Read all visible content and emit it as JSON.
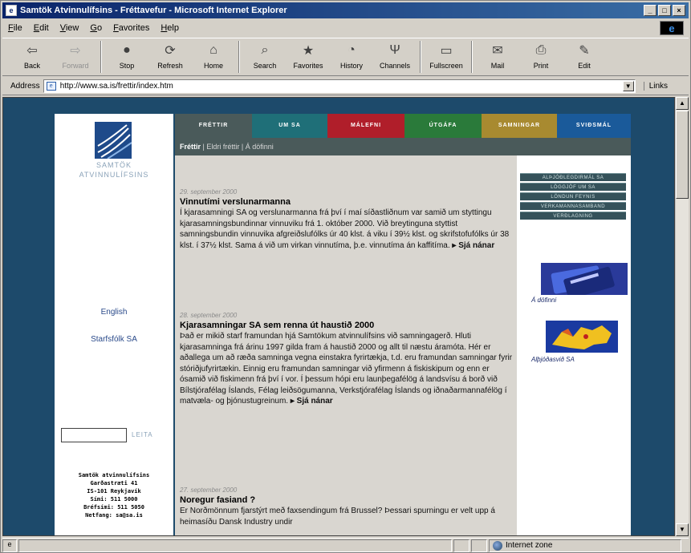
{
  "window": {
    "title": "Samtök Atvinnulífsins - Fréttavefur - Microsoft Internet Explorer",
    "controls": [
      "_",
      "□",
      "×"
    ]
  },
  "menu": [
    "File",
    "Edit",
    "View",
    "Go",
    "Favorites",
    "Help"
  ],
  "toolbar": {
    "buttons": [
      {
        "label": "Back",
        "icon": "back-arrow-icon",
        "glyph": "⇦"
      },
      {
        "label": "Forward",
        "icon": "forward-arrow-icon",
        "glyph": "⇨"
      },
      {
        "label": "Stop",
        "icon": "stop-icon",
        "glyph": "●"
      },
      {
        "label": "Refresh",
        "icon": "refresh-icon",
        "glyph": "⟳"
      },
      {
        "label": "Home",
        "icon": "home-icon",
        "glyph": "⌂"
      },
      {
        "label": "Search",
        "icon": "search-icon",
        "glyph": "⌕"
      },
      {
        "label": "Favorites",
        "icon": "favorites-icon",
        "glyph": "★"
      },
      {
        "label": "History",
        "icon": "history-icon",
        "glyph": "◔"
      },
      {
        "label": "Channels",
        "icon": "channels-icon",
        "glyph": "Ψ"
      },
      {
        "label": "Fullscreen",
        "icon": "fullscreen-icon",
        "glyph": "▭"
      },
      {
        "label": "Mail",
        "icon": "mail-icon",
        "glyph": "✉"
      },
      {
        "label": "Print",
        "icon": "print-icon",
        "glyph": "⎙"
      },
      {
        "label": "Edit",
        "icon": "edit-icon",
        "glyph": "✎"
      }
    ]
  },
  "address": {
    "label": "Address",
    "url": "http://www.sa.is/frettir/index.htm",
    "links_label": "Links"
  },
  "page": {
    "logo_text_line1": "SAMTÖK",
    "logo_text_line2": "ATVINNULÍFSINS",
    "side_links": [
      "English",
      "Starfsfólk SA"
    ],
    "search_button": "LEITA",
    "contact": [
      "Samtök atvinnulífsins",
      "Garðastræti 41",
      "IS-101 Reykjavík",
      "Sími: 511 5000",
      "Bréfsími: 511 5050",
      "Netfang: sa@sa.is"
    ],
    "nav_tabs": [
      {
        "label": "FRÉTTIR",
        "color": "#4a5a5a"
      },
      {
        "label": "UM SA",
        "color": "#1f6f78"
      },
      {
        "label": "MÁLEFNI",
        "color": "#b01e2a"
      },
      {
        "label": "ÚTGÁFA",
        "color": "#2a7a3a"
      },
      {
        "label": "SAMNINGAR",
        "color": "#a88a30"
      },
      {
        "label": "SVIÐSMÁL",
        "color": "#1a5a9a"
      }
    ],
    "subnav": {
      "active": "Fréttir",
      "items": "| Eldri fréttir | Á döfinni"
    },
    "articles": [
      {
        "date": "29. september 2000",
        "headline": "Vinnutími verslunarmanna",
        "body": "Í kjarasamningi SA og verslunarmanna frá því í maí síðastliðnum var samið um styttingu kjarasamningsbundinnar vinnuviku frá 1. október 2000. Við breytinguna styttist samningsbundin vinnuvika afgreiðslufólks úr 40 klst. á viku í 39½ klst. og skrifstofufólks úr 38 klst. í 37½ klst. Sama á við um virkan vinnutíma, þ.e. vinnutíma án kaffitíma. ",
        "more": "▸ Sjá nánar"
      },
      {
        "date": "28. september 2000",
        "headline": "Kjarasamningar SA sem renna út haustið 2000",
        "body": "Það er mikið starf framundan hjá Samtökum atvinnulífsins við samningagerð. Hluti kjarasamninga frá árinu 1997 gilda fram á haustið 2000 og allt til næstu áramóta. Hér er aðallega um að ræða samninga vegna einstakra fyrirtækja, t.d. eru framundan samningar fyrir stóriðjufyrirtækin. Einnig eru framundan samningar við yfirmenn á fiskiskipum og enn er ósamið við fiskimenn frá því í vor. Í þessum hópi eru launþegafélög á landsvísu á borð við Bílstjórafélag Íslands, Félag leiðsögumanna, Verkstjórafélag Íslands og iðnaðarmannafélög í matvæla- og þjónustugreinum. ",
        "more": "▸ Sjá nánar"
      },
      {
        "date": "27. september 2000",
        "headline": "Noregur fasiand ?",
        "body": "Er Norðmönnum fjarstýrt með faxsendingum frá Brussel? Þessari spurningu er velt upp á heimasíðu Dansk Industry undir",
        "more": ""
      }
    ],
    "right_buttons": [
      "ALÞJÓÐLEGDIRMÁL SA",
      "LÖGGJÖF UM SA",
      "LÖNDUN FEYNIS",
      "VERKAMANNASAMBAND",
      "VERÐLAGNING"
    ],
    "right_images": [
      {
        "label": "Á döfinni",
        "icon": "credit-card-icon"
      },
      {
        "label": "Alþjóðasvið SA",
        "icon": "europe-map-icon"
      }
    ]
  },
  "status": {
    "text": "",
    "zone": "Internet zone"
  }
}
